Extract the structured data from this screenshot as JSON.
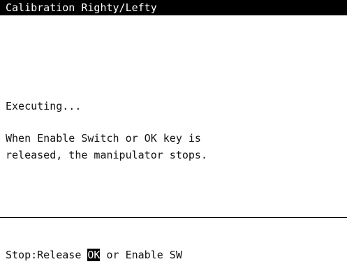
{
  "window": {
    "title": "Calibration Righty/Lefty"
  },
  "main": {
    "status": "Executing...",
    "message_line1": "When Enable Switch or OK key is",
    "message_line2": "released, the manipulator stops."
  },
  "footer": {
    "prefix": "Stop:Release ",
    "ok_key": "OK",
    "suffix": " or Enable SW"
  }
}
